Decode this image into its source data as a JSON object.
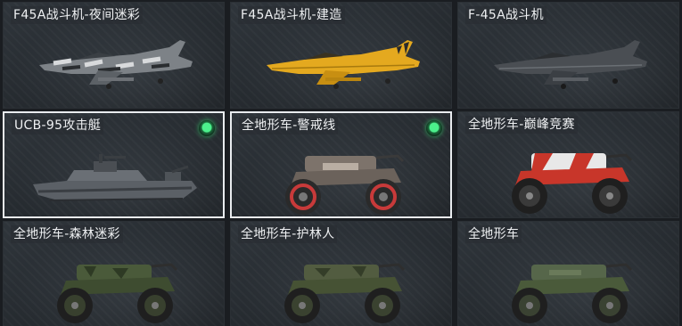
{
  "items": [
    {
      "label": "F45A战斗机-夜间迷彩",
      "kind": "jet",
      "skin": "camo-night",
      "selected": false,
      "equipped": false
    },
    {
      "label": "F45A战斗机-建造",
      "kind": "jet",
      "skin": "yellow",
      "selected": false,
      "equipped": false
    },
    {
      "label": "F-45A战斗机",
      "kind": "jet",
      "skin": "grey",
      "selected": false,
      "equipped": false
    },
    {
      "label": "UCB-95攻击艇",
      "kind": "boat",
      "skin": "grey",
      "selected": true,
      "equipped": true
    },
    {
      "label": "全地形车-警戒线",
      "kind": "atv",
      "skin": "warning",
      "selected": true,
      "equipped": true
    },
    {
      "label": "全地形车-巅峰竞赛",
      "kind": "atv",
      "skin": "race-red",
      "selected": false,
      "equipped": false
    },
    {
      "label": "全地形车-森林迷彩",
      "kind": "atv",
      "skin": "forest-camo",
      "selected": false,
      "equipped": false
    },
    {
      "label": "全地形车-护林人",
      "kind": "atv",
      "skin": "ranger",
      "selected": false,
      "equipped": false
    },
    {
      "label": "全地形车",
      "kind": "atv",
      "skin": "green",
      "selected": false,
      "equipped": false
    }
  ],
  "colors": {
    "equipped_badge": "#3be07a",
    "selected_border": "#e9ecef",
    "jet_camo": "#8a8e92",
    "jet_yellow": "#e4a91f",
    "jet_grey": "#4a4e53",
    "atv_green": "#4a5a3a",
    "atv_red": "#c8362a"
  },
  "icons": {
    "equipped": "equipped-check-icon"
  }
}
